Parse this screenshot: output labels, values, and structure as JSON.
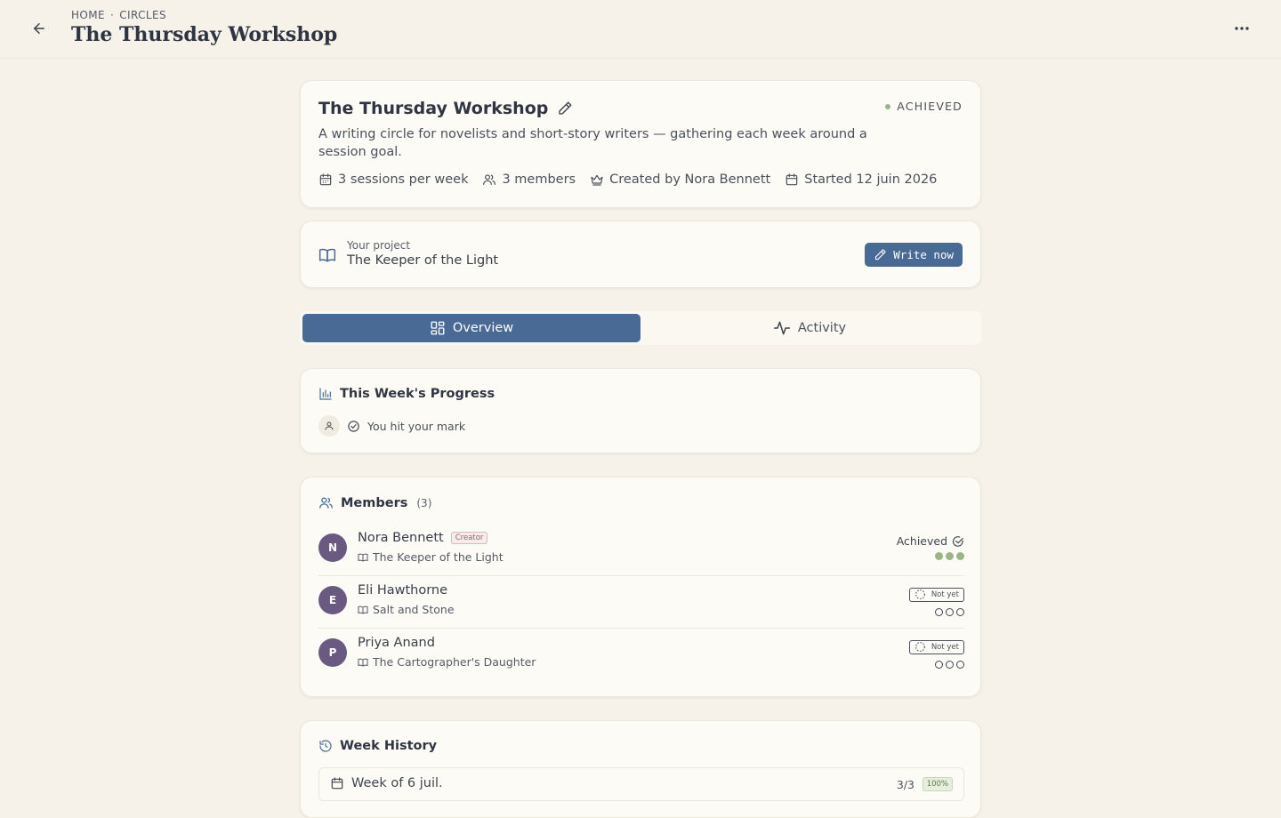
{
  "header": {
    "breadcrumb": [
      "HOME",
      "CIRCLES"
    ],
    "breadcrumb_separator": "·",
    "title": "The Thursday Workshop"
  },
  "circle": {
    "title": "The Thursday Workshop",
    "status": "ACHIEVED",
    "description": "A writing circle for novelists and short-story writers — gathering each week around a session goal.",
    "meta": {
      "sessions": "3 sessions per week",
      "members": "3 members",
      "creator": "Created by Nora Bennett",
      "started": "Started 12 juin 2026"
    }
  },
  "project": {
    "label": "Your project",
    "name": "The Keeper of the Light",
    "write_label": "Write now"
  },
  "tabs": [
    {
      "label": "Overview",
      "active": true
    },
    {
      "label": "Activity",
      "active": false
    }
  ],
  "progress": {
    "title": "This Week's Progress",
    "message": "You hit your mark"
  },
  "members": {
    "title": "Members",
    "count": "(3)",
    "list": [
      {
        "initial": "N",
        "name": "Nora Bennett",
        "badge": "Creator",
        "book": "The Keeper of the Light",
        "status": "Achieved",
        "sessions_done": 3,
        "sessions_total": 3
      },
      {
        "initial": "E",
        "name": "Eli Hawthorne",
        "badge": "",
        "book": "Salt and Stone",
        "status": "Not yet",
        "sessions_done": 0,
        "sessions_total": 3
      },
      {
        "initial": "P",
        "name": "Priya Anand",
        "badge": "",
        "book": "The Cartographer's Daughter",
        "status": "Not yet",
        "sessions_done": 0,
        "sessions_total": 3
      }
    ]
  },
  "history": {
    "title": "Week History",
    "weeks": [
      {
        "label": "Week of 6 juil.",
        "score": "3/3",
        "percent": "100%"
      }
    ]
  },
  "colors": {
    "accent": "#4a6a96",
    "achieved": "#9bb586",
    "avatar": "#6a5a82",
    "background": "#f6f2ea"
  }
}
